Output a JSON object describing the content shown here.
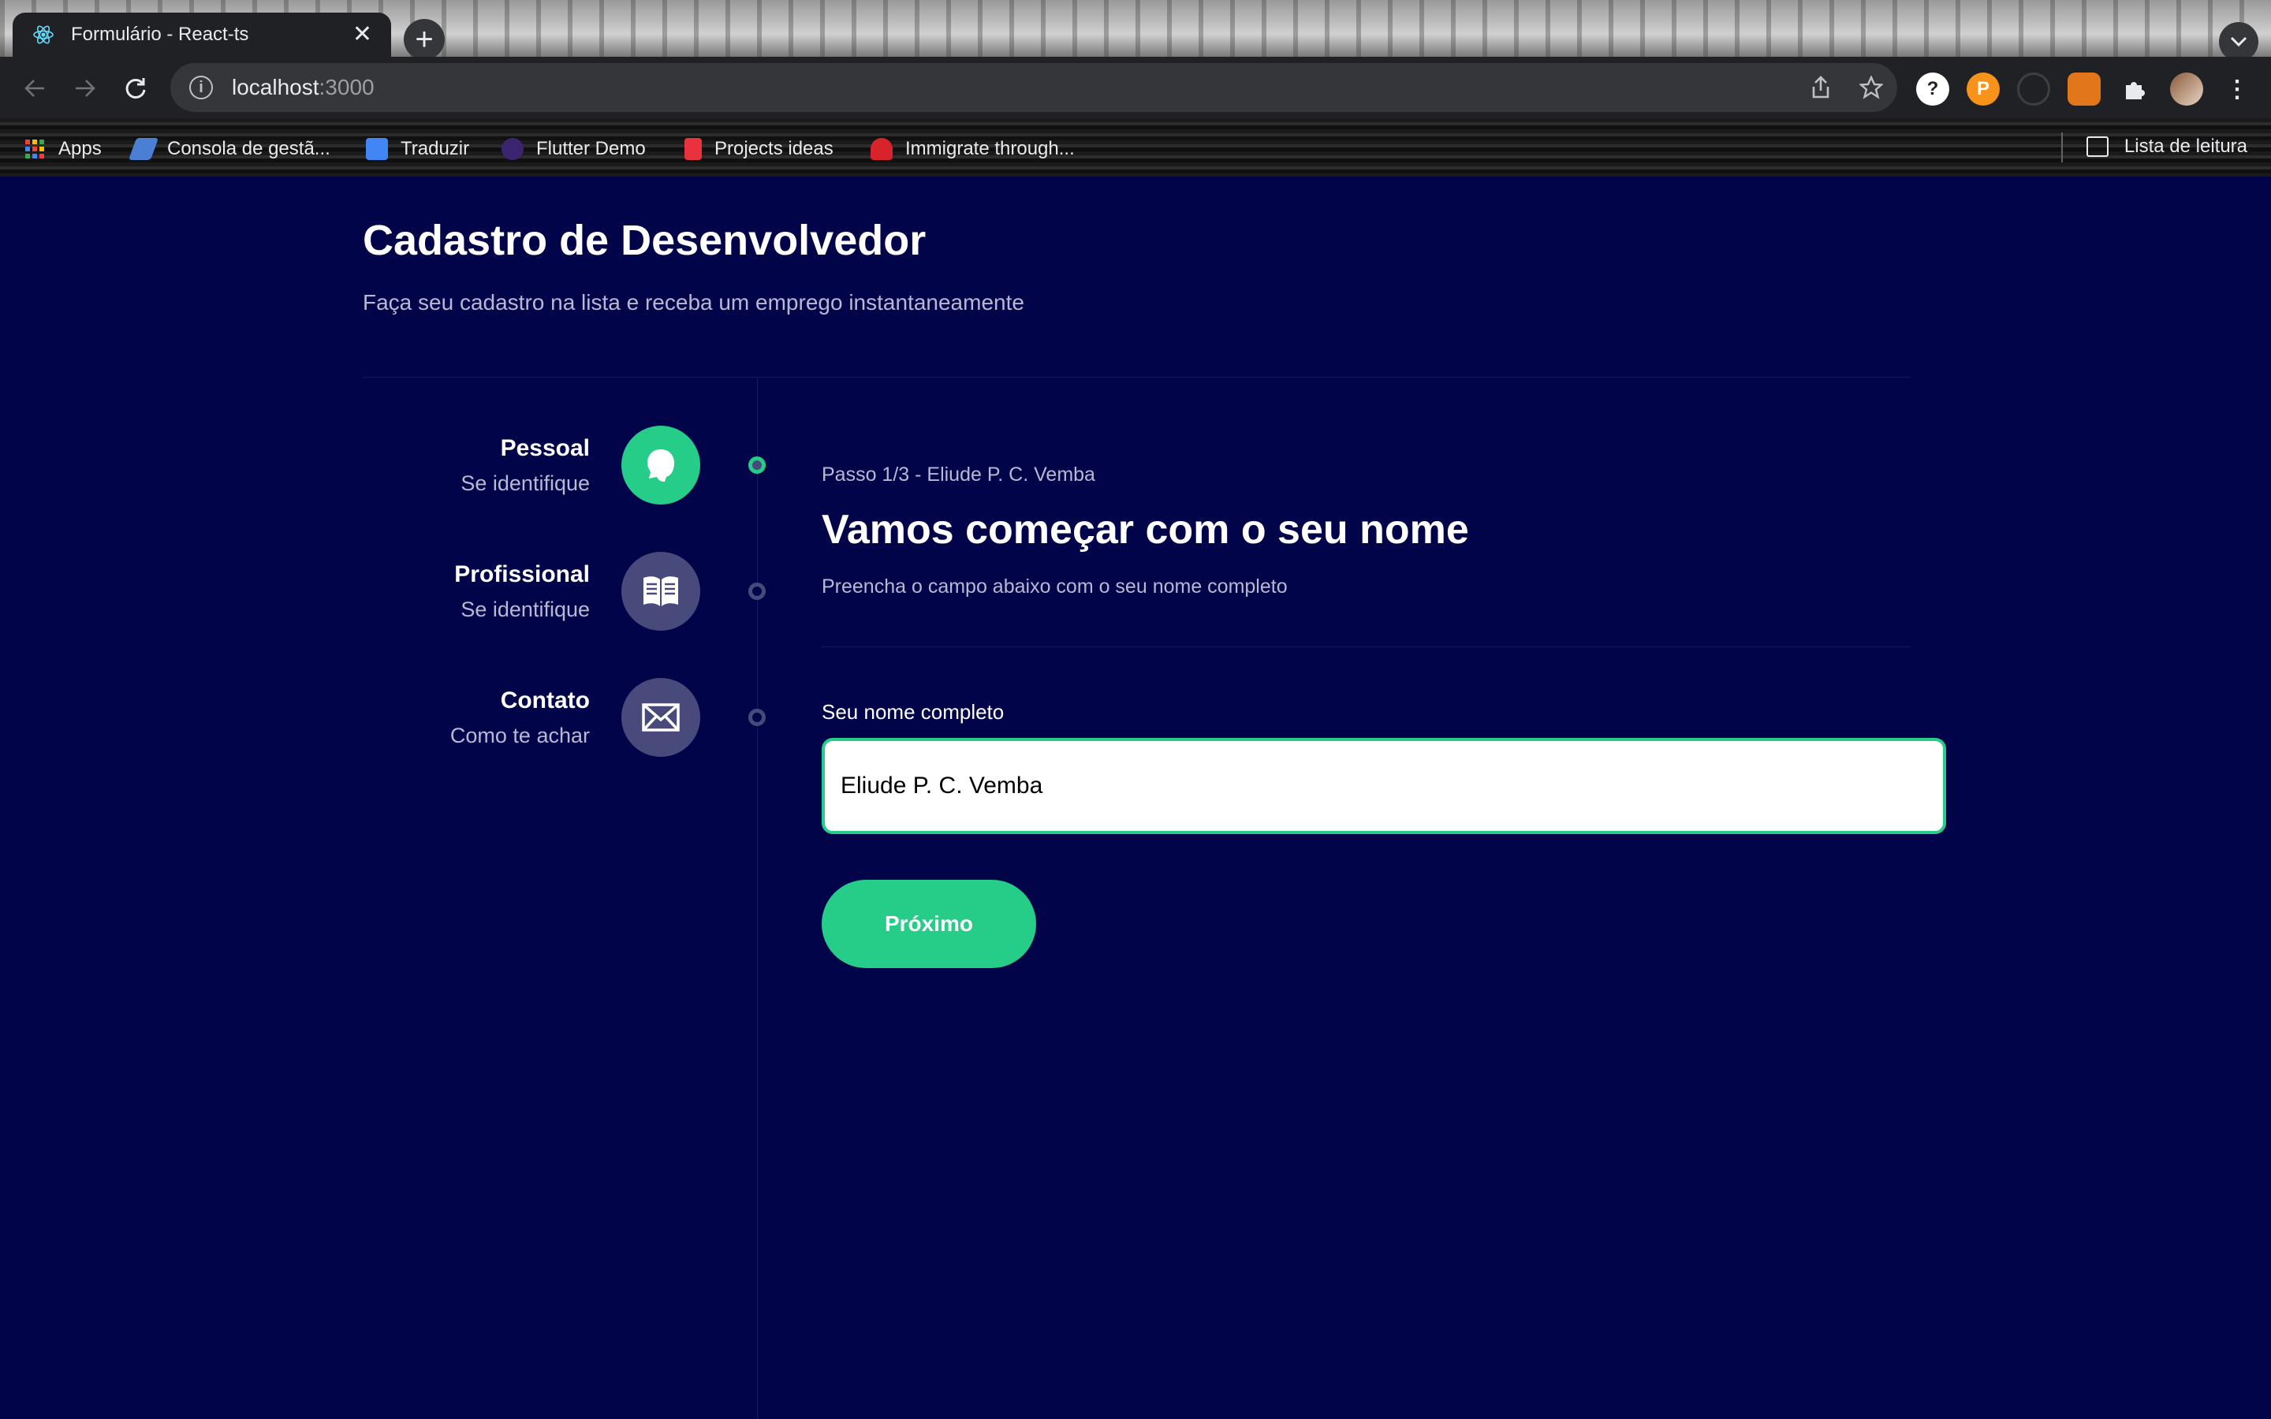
{
  "browser": {
    "tab_title": "Formulário - React-ts",
    "tab_close": "✕",
    "new_tab": "+",
    "url_host": "localhost",
    "url_port": ":3000",
    "bookmarks": [
      {
        "label": "Apps",
        "color": "#ea4335"
      },
      {
        "label": "Consola de gestã...",
        "color": "#4a7fd4"
      },
      {
        "label": "Traduzir",
        "color": "#4285f4"
      },
      {
        "label": "Flutter Demo",
        "color": "#7a3fd0"
      },
      {
        "label": "Projects ideas",
        "color": "#e8333f"
      },
      {
        "label": "Immigrate through...",
        "color": "#d8232a"
      }
    ],
    "reading_list": "Lista de leitura"
  },
  "page": {
    "title": "Cadastro de Desenvolvedor",
    "subtitle": "Faça seu cadastro na lista e receba um emprego instantaneamente"
  },
  "steps": [
    {
      "title": "Pessoal",
      "desc": "Se identifique",
      "icon": "profile-icon",
      "active": true
    },
    {
      "title": "Profissional",
      "desc": "Se identifique",
      "icon": "book-icon",
      "active": false
    },
    {
      "title": "Contato",
      "desc": "Como te achar",
      "icon": "mail-icon",
      "active": false
    }
  ],
  "form": {
    "step_info": "Passo 1/3 - Eliude P. C. Vemba",
    "heading": "Vamos começar com o seu nome",
    "description": "Preencha o campo abaixo com o seu nome completo",
    "field_label": "Seu nome completo",
    "field_value": "Eliude P. C. Vemba",
    "next_button": "Próximo"
  },
  "colors": {
    "background": "#02044A",
    "accent": "#25CD89",
    "inactive": "#494A7C",
    "muted_text": "#B8B8D4"
  }
}
